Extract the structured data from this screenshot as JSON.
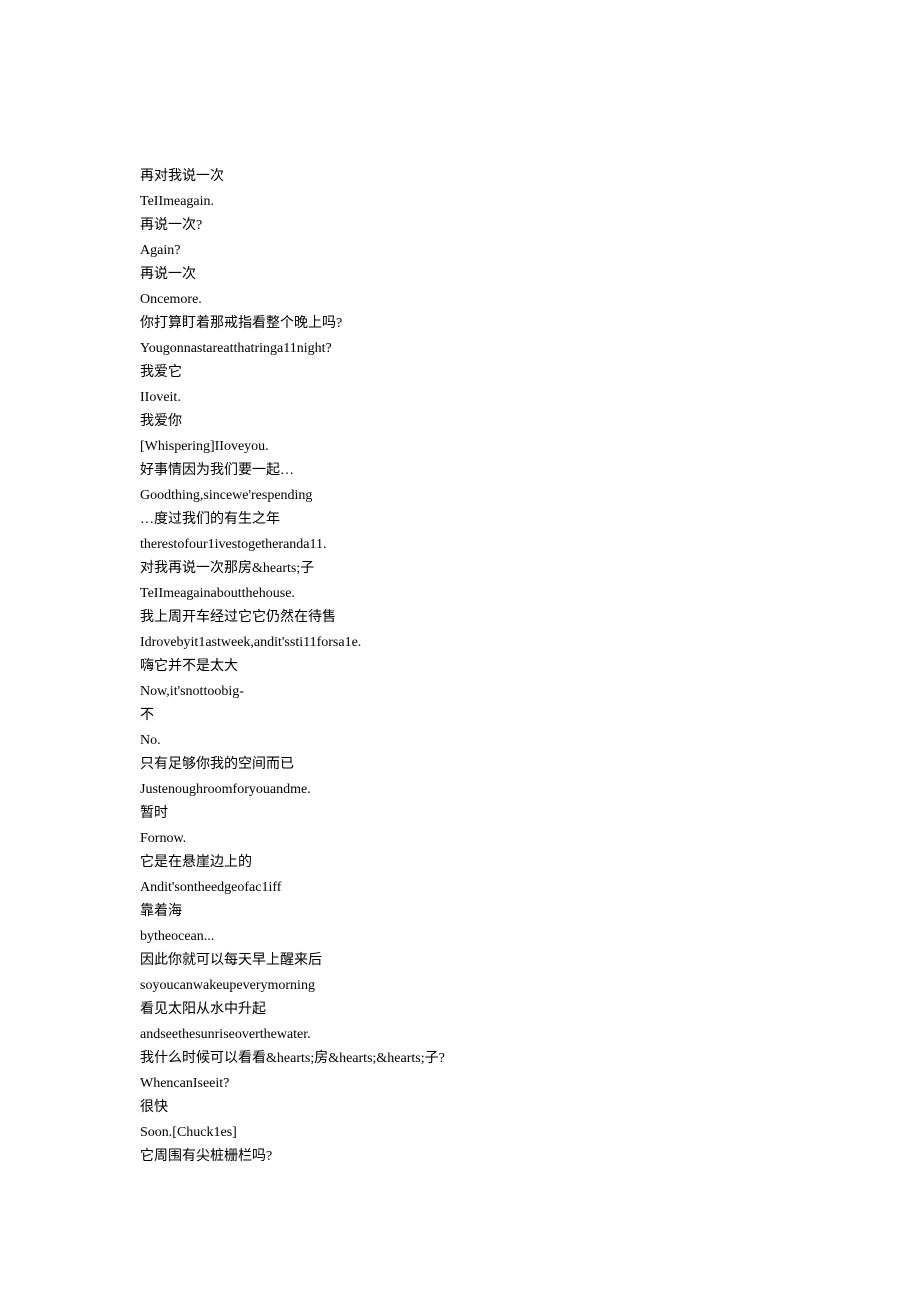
{
  "lines": [
    "再对我说一次",
    "TeIImeagain.",
    "再说一次?",
    "Again?",
    "再说一次",
    "Oncemore.",
    "你打算盯着那戒指看整个晚上吗?",
    "Yougonnastareatthatringa11night?",
    "我爱它",
    "IIoveit.",
    "我爱你",
    "[Whispering]IIoveyou.",
    "好事情因为我们要一起…",
    "Goodthing,sincewe'respending",
    "…度过我们的有生之年",
    "therestofour1ivestogetheranda11.",
    "对我再说一次那房&hearts;子",
    "TeIImeagainaboutthehouse.",
    "我上周开车经过它它仍然在待售",
    "Idrovebyit1astweek,andit'ssti11forsa1e.",
    "嗨它并不是太大",
    "Now,it'snottoobig-",
    "不",
    "No.",
    "只有足够你我的空间而已",
    "Justenoughroomforyouandme.",
    "暂时",
    "Fornow.",
    "它是在悬崖边上的",
    "Andit'sontheedgeofac1iff",
    "靠着海",
    "bytheocean...",
    "因此你就可以每天早上醒来后",
    "soyoucanwakeupeverymorning",
    "看见太阳从水中升起",
    "andseethesunriseoverthewater.",
    "我什么时候可以看看&hearts;房&hearts;&hearts;子?",
    "WhencanIseeit?",
    "很快",
    "Soon.[Chuck1es]",
    "它周围有尖桩栅栏吗?"
  ]
}
